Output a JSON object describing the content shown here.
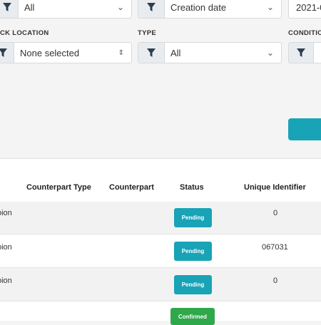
{
  "colors": {
    "pending": "#18a3b7",
    "confirmed": "#2ea84a",
    "accent": "#18a3b7"
  },
  "filters": {
    "row1": [
      {
        "value": "All"
      },
      {
        "value": "Creation date"
      },
      {
        "value": "2021-0"
      }
    ],
    "row2": [
      {
        "label": "CK LOCATION",
        "value": "None selected"
      },
      {
        "label": "TYPE",
        "value": "All"
      },
      {
        "label": "CONDITIO",
        "value": ""
      }
    ]
  },
  "table": {
    "headers": [
      "Counterpart Type",
      "Counterpart",
      "Status",
      "Unique Identifier"
    ],
    "rows": [
      {
        "first": "oion",
        "status": "Pending",
        "uid": "0"
      },
      {
        "first": "oion",
        "status": "Pending",
        "uid": "067031"
      },
      {
        "first": "oion",
        "status": "Pending",
        "uid": "0"
      },
      {
        "first": "",
        "status": "Confirmed",
        "uid": ""
      }
    ]
  }
}
